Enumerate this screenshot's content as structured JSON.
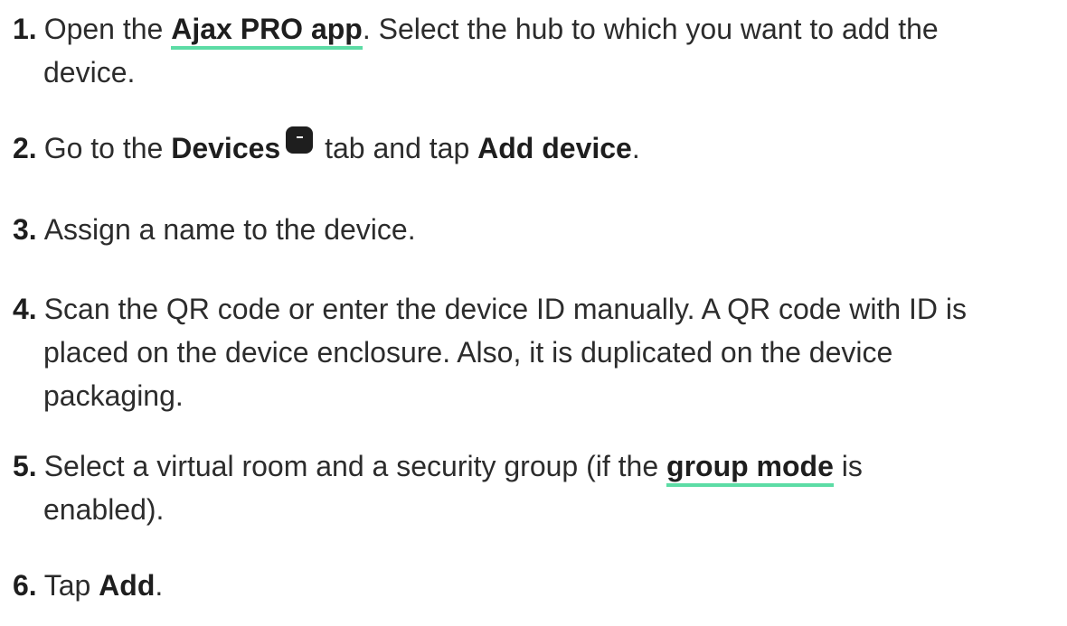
{
  "steps": [
    {
      "num": "1.",
      "pre": "Open the ",
      "link": "Ajax PRO app",
      "post": ". Select the hub to which you want to add the",
      "line2": "device."
    },
    {
      "num": "2.",
      "pre": "Go to the ",
      "bold1": "Devices",
      "icon": "devices-icon",
      "mid": " tab and tap ",
      "bold2": "Add device",
      "post": "."
    },
    {
      "num": "3.",
      "text": "Assign a name to the device."
    },
    {
      "num": "4.",
      "line1": "Scan the QR code or enter the device ID manually. A QR code with ID is",
      "line2": "placed on the device enclosure. Also, it is duplicated on the device",
      "line3": "packaging."
    },
    {
      "num": "5.",
      "pre": "Select a virtual room and a security group (if the ",
      "link": "group mode",
      "post": " is",
      "line2": "enabled)."
    },
    {
      "num": "6.",
      "pre": "Tap ",
      "bold": "Add",
      "post": "."
    }
  ],
  "colors": {
    "text": "#2c2c2c",
    "link_underline": "#5cdca5",
    "icon_bg": "#1e1e1e"
  }
}
